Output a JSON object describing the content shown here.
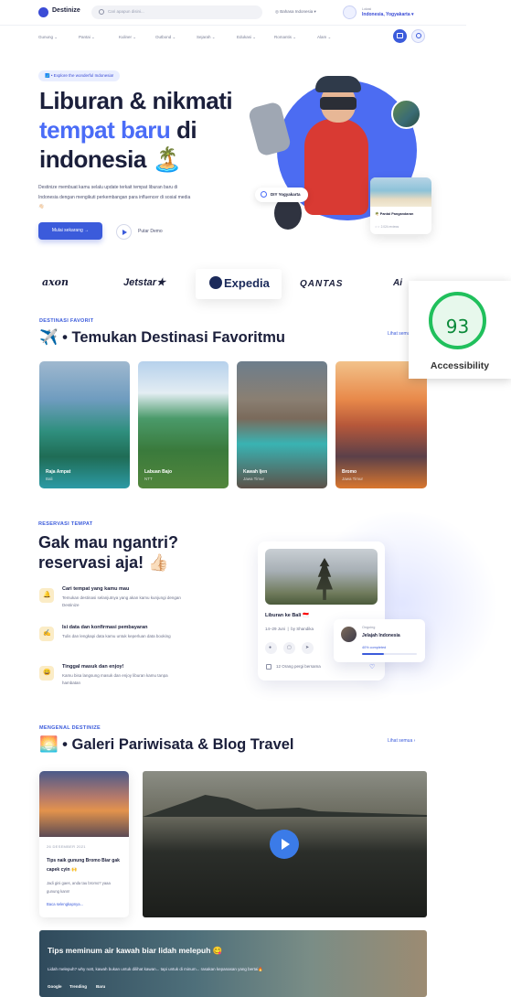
{
  "header": {
    "brand": "Destinize",
    "search_placeholder": "Cari apapun disini...",
    "language": "Bahasa Indonesia",
    "location_label": "Lokasi",
    "location_value": "Indonesia, Yogyakarta"
  },
  "nav": {
    "items": [
      "Gunung",
      "Pantai",
      "Kuliner",
      "Outbond",
      "Sejarah",
      "Edukasi",
      "Romantis",
      "Alam"
    ]
  },
  "hero": {
    "tag": "🗾 • Explore the wonderful Indonesia!",
    "title_line1": "Liburan & nikmati",
    "title_line2_blue": "tempat baru",
    "title_line2_rest": " di",
    "title_line3": "indonesia 🏝️",
    "description": "Destinize membuat kamu selalu update terkait tempat liburan baru di Indonesia dengan mengikuti perkembangan para influencer di sosial media 👋🏻",
    "cta_primary": "Mulai sekarang →",
    "cta_secondary": "Putar Demo",
    "location_pill": "DIY Yogyakarta",
    "card_title": "🌴 Pantai Pangandaran",
    "card_meta": "☆☆ 2.024 reviews"
  },
  "partners": [
    "axon",
    "Jetstar★",
    "Expedia",
    "QANTAS",
    "Ai"
  ],
  "accessibility": {
    "score": 93,
    "label": "Accessibility"
  },
  "favorites": {
    "eyebrow": "DESTINASI FAVORIT",
    "title": "✈️ • Temukan Destinasi Favoritmu",
    "see_all": "Lihat semua",
    "items": [
      {
        "name": "Raja Ampat",
        "location": "Bali"
      },
      {
        "name": "Labuan Bajo",
        "location": "NTT"
      },
      {
        "name": "Kawah Ijen",
        "location": "Jawa Timur"
      },
      {
        "name": "Bromo",
        "location": "Jawa Timur"
      }
    ]
  },
  "reservation": {
    "eyebrow": "RESERVASI TEMPAT",
    "title_line1": "Gak mau ngantri?",
    "title_line2": "reservasi aja! 👍🏻",
    "steps": [
      {
        "icon": "🔔",
        "title": "Cari tempat yang kamu mau",
        "desc": "Temukan destinasi selanjutnya yang akan kamu kunjungi dengan Destinize"
      },
      {
        "icon": "✍️",
        "title": "Isi data dan konfirmasi pembayaran",
        "desc": "Tulis dan lengkapi data kamu untuk keperluan data booking"
      },
      {
        "icon": "😀",
        "title": "Tinggal masuk dan enjoy!",
        "desc": "Kamu bisa langsung masuk dan enjoy liburan kamu tanpa hambatan"
      }
    ],
    "card": {
      "title": "Liburan ke Bali 🇮🇩",
      "dates": "14–29 Juni",
      "separator": "|",
      "by": "by Shandika",
      "people": "12 Orang pergi bersama",
      "icons": [
        "●",
        "▢",
        "➤"
      ],
      "heart": "♡"
    },
    "ongoing": {
      "label": "Ongoing",
      "title": "Jelajah Indonesia",
      "progress_label": "40% completed",
      "progress": 0.4
    }
  },
  "gallery": {
    "eyebrow": "MENGENAL DESTINIZE",
    "title": "🌅 • Galeri Pariwisata & Blog Travel",
    "see_all": "Lihat semua",
    "blog": {
      "date": "26 DESEMBER 2021",
      "title": "Tips naik gunung Bromo Biar gak capek cyin 🙌",
      "desc": "Jadi gini gaes, anda tau bromo? yaaa gunung kann!",
      "link": "Baca selengkapnya..."
    },
    "banner": {
      "title": "Tips meminum air kawah biar lidah melepuh 😋",
      "desc": "Lidah melepuh? why nott, kawah bukan untuk dilihat kawan... tapi untuk di minum... rasakan kepanasan yang bertai🔥",
      "tags": [
        "Google",
        "Trending",
        "Baru"
      ]
    }
  },
  "colors": {
    "primary": "#3b5bdb",
    "accent_blue": "#4a6cf7",
    "a11y_green": "#20c05c"
  }
}
